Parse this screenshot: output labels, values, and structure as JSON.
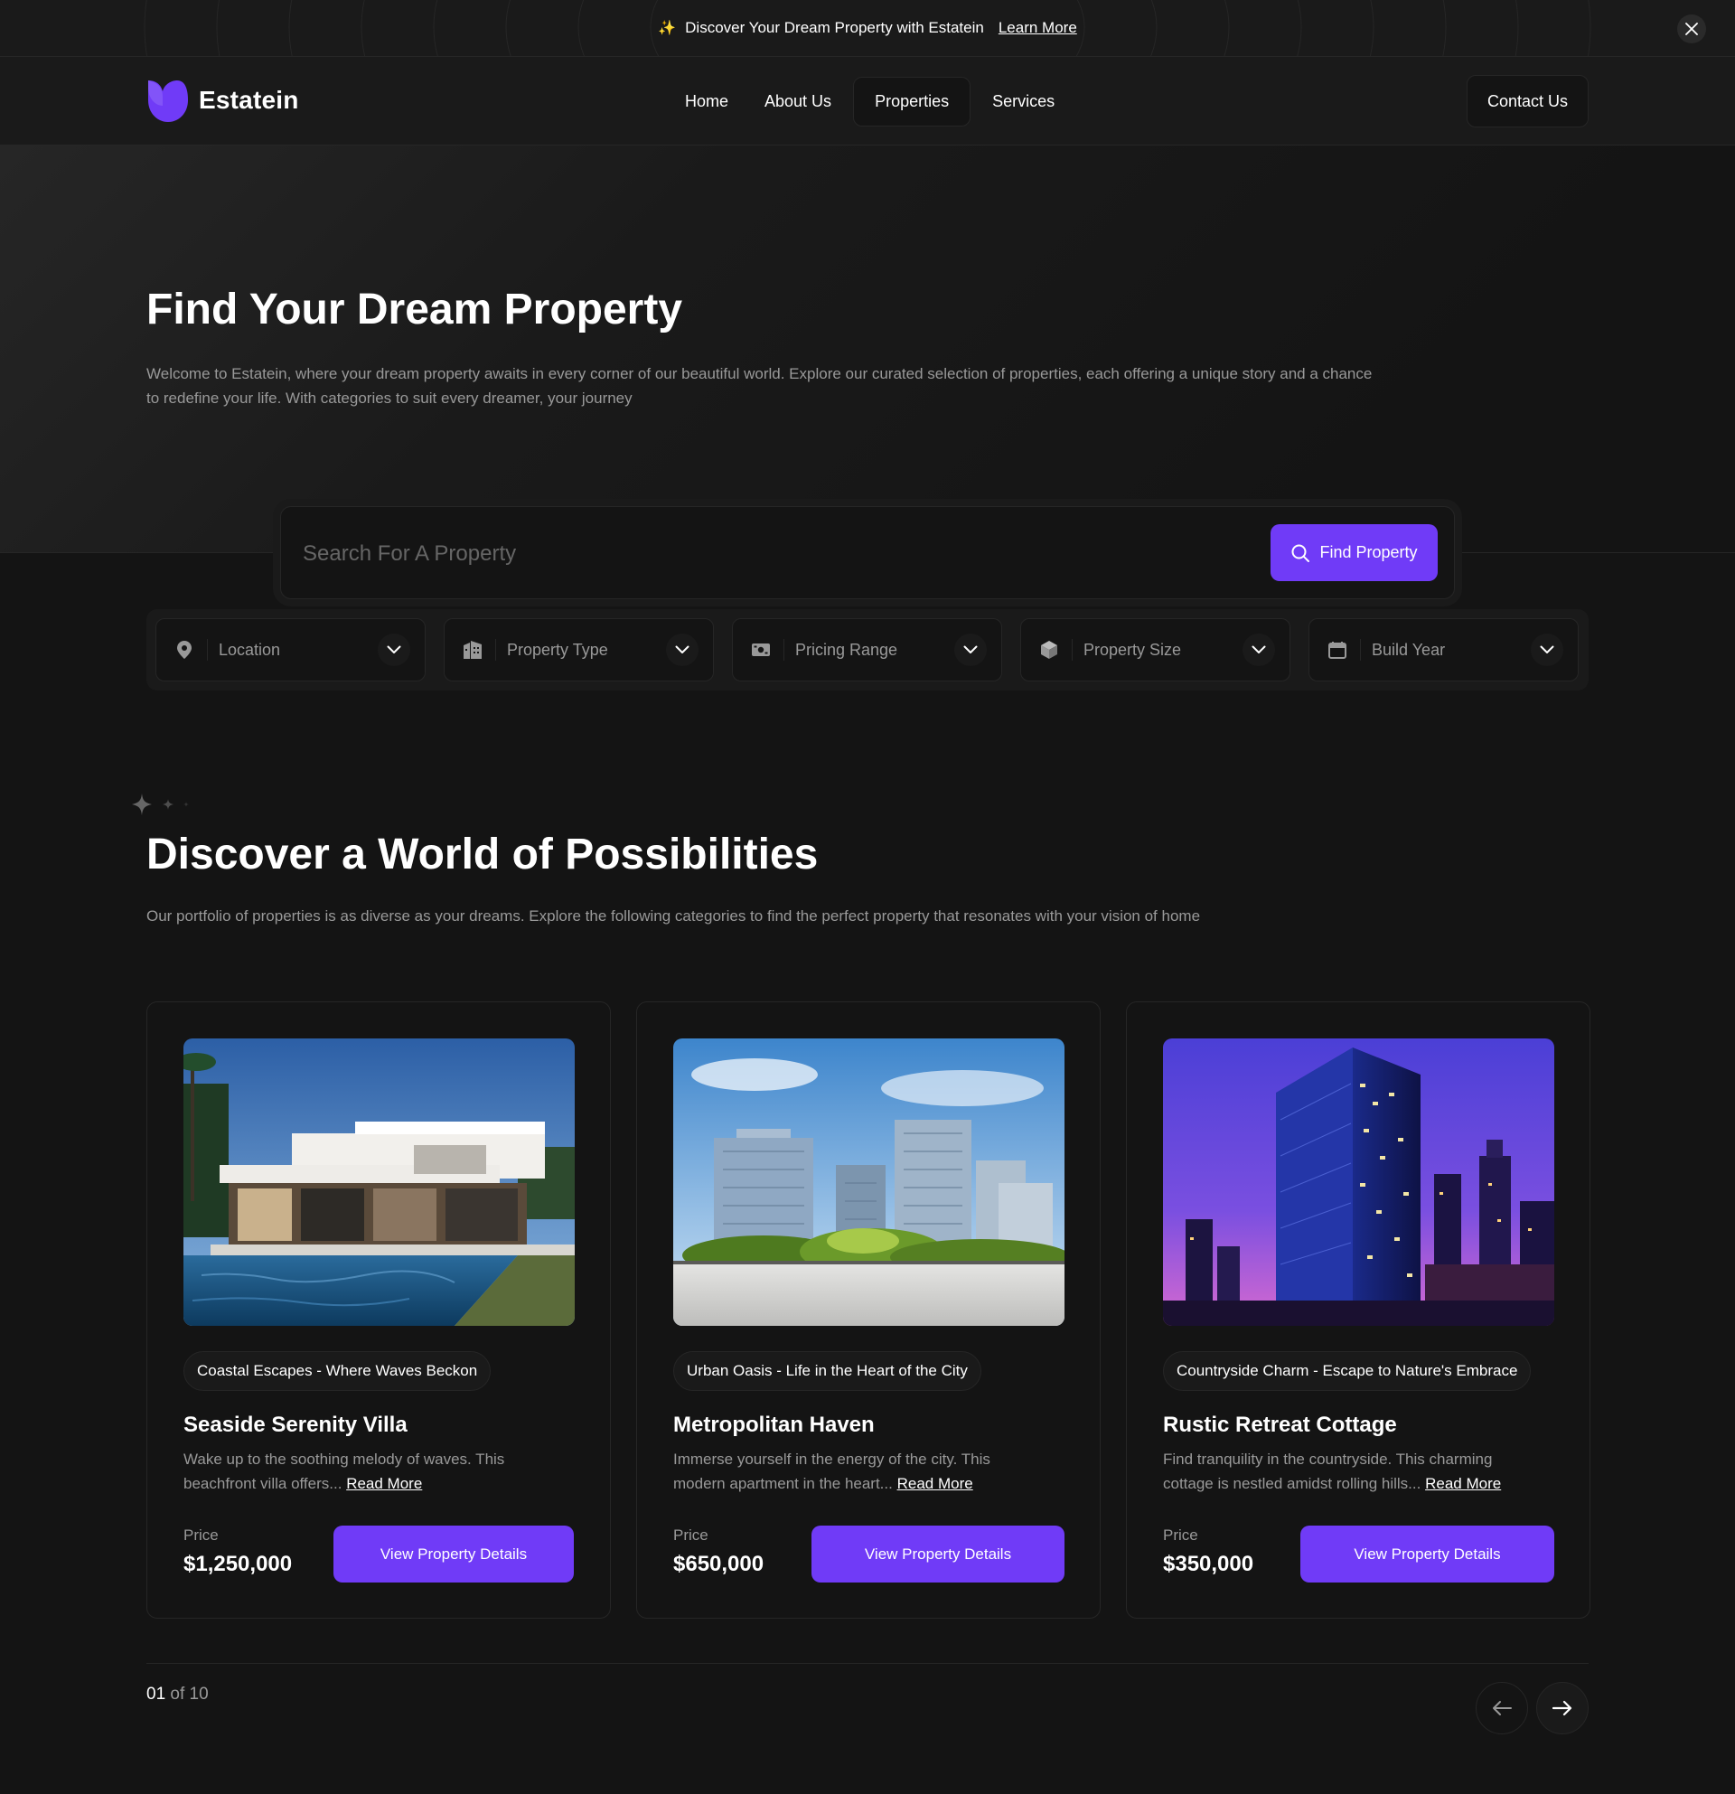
{
  "banner": {
    "star": "✨",
    "text": "Discover Your Dream Property with Estatein",
    "link": "Learn More"
  },
  "brand": {
    "name": "Estatein",
    "accent_color": "#703bf7"
  },
  "nav": {
    "links": [
      "Home",
      "About Us",
      "Properties",
      "Services"
    ],
    "active": "Properties",
    "contact": "Contact Us"
  },
  "hero": {
    "title": "Find Your Dream Property",
    "description": "Welcome to Estatein, where your dream property awaits in every corner of our beautiful world. Explore our curated selection of properties, each offering a unique story and a chance to redefine your life. With categories to suit every dreamer, your journey"
  },
  "search": {
    "placeholder": "Search For A Property",
    "button": "Find Property"
  },
  "filters": [
    {
      "label": "Location",
      "icon": "location-pin-icon"
    },
    {
      "label": "Property Type",
      "icon": "building-icon"
    },
    {
      "label": "Pricing Range",
      "icon": "cash-icon"
    },
    {
      "label": "Property Size",
      "icon": "cube-icon"
    },
    {
      "label": "Build Year",
      "icon": "calendar-icon"
    }
  ],
  "section": {
    "title": "Discover a World of Possibilities",
    "description": "Our portfolio of properties is as diverse as your dreams. Explore the following categories to find the perfect property that resonates with your vision of home"
  },
  "properties": [
    {
      "tag": "Coastal Escapes - Where Waves Beckon",
      "title": "Seaside Serenity Villa",
      "description": "Wake up to the soothing melody of waves. This beachfront villa offers...",
      "read_more": "Read More",
      "price_label": "Price",
      "price": "$1,250,000",
      "button": "View Property Details"
    },
    {
      "tag": "Urban Oasis - Life in the Heart of the City",
      "title": "Metropolitan Haven",
      "description": "Immerse yourself in the energy of the city. This modern apartment in the heart...",
      "read_more": "Read More",
      "price_label": "Price",
      "price": "$650,000",
      "button": "View Property Details"
    },
    {
      "tag": "Countryside Charm - Escape to Nature's Embrace",
      "title": "Rustic Retreat Cottage",
      "description": "Find tranquility in the countryside. This charming cottage is nestled amidst rolling hills...",
      "read_more": "Read More",
      "price_label": "Price",
      "price": "$350,000",
      "button": "View Property Details"
    }
  ],
  "pagination": {
    "current": "01",
    "of_text": " of 10"
  }
}
